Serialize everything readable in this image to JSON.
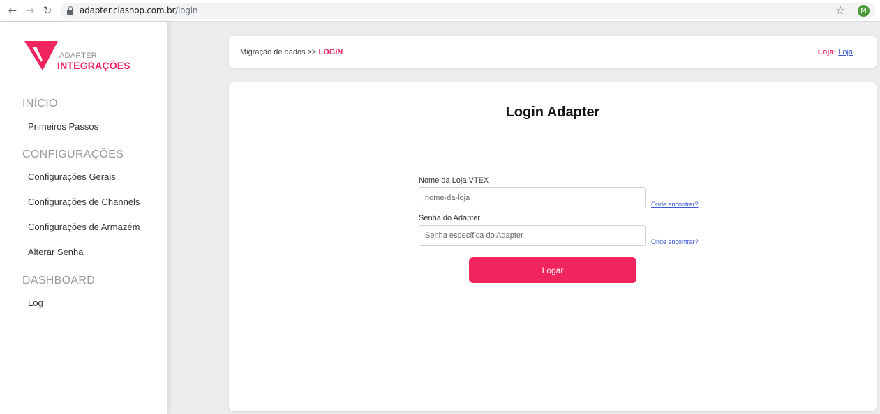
{
  "browser": {
    "url_host": "adapter.ciashop.com.br",
    "url_path": "/login",
    "profile_initial": "M",
    "back_icon": "←",
    "forward_icon": "→",
    "reload_icon": "↻",
    "star_icon": "☆"
  },
  "brand": {
    "logo_sub": "ADAPTER",
    "logo_main": "INTEGRAÇÕES",
    "accent_color": "#f0245e"
  },
  "sidebar": {
    "sections": [
      {
        "title": "INÍCIO",
        "items": [
          "Primeiros Passos"
        ]
      },
      {
        "title": "CONFIGURAÇÕES",
        "items": [
          "Configurações Gerais",
          "Configurações de Channels",
          "Configurações de Armazém",
          "Alterar Senha"
        ]
      },
      {
        "title": "DASHBOARD",
        "items": [
          "Log"
        ]
      }
    ]
  },
  "header": {
    "breadcrumb_prefix": "Migração de dados >>",
    "breadcrumb_current": "LOGIN",
    "store_label": "Loja:",
    "store_link": "Loja"
  },
  "form": {
    "title": "Login Adapter",
    "store_name_label": "Nome da Loja VTEX",
    "store_name_placeholder": "nome-da-loja",
    "password_label": "Senha do Adapter",
    "password_placeholder": "Senha específica do Adapter",
    "help_link": "Onde encontrar?",
    "submit_label": "Logar"
  }
}
